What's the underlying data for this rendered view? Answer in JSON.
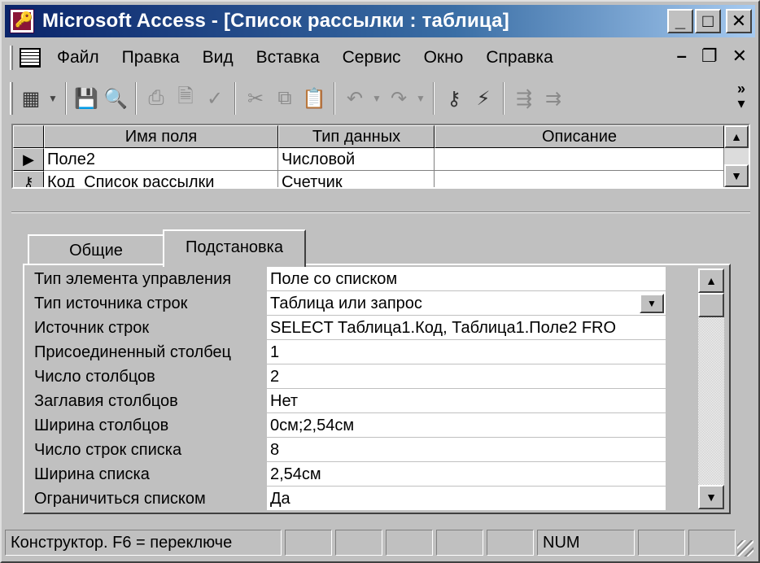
{
  "window": {
    "title": "Microsoft Access - [Список рассылки : таблица]",
    "buttons": {
      "minimize": "_",
      "maximize": "□",
      "close": "✕"
    }
  },
  "menu": {
    "items": [
      {
        "label": "Файл"
      },
      {
        "label": "Правка"
      },
      {
        "label": "Вид"
      },
      {
        "label": "Вставка"
      },
      {
        "label": "Сервис"
      },
      {
        "label": "Окно"
      },
      {
        "label": "Справка"
      }
    ],
    "doc_buttons": {
      "minimize": "–",
      "restore": "❐",
      "close": "✕"
    }
  },
  "toolbar": {
    "icons": [
      "view-icon",
      "save-icon",
      "search-icon",
      "print-icon",
      "print-preview-icon",
      "spelling-icon",
      "cut-icon",
      "copy-icon",
      "paste-icon",
      "undo-icon",
      "redo-icon",
      "primary-key-icon",
      "indexes-icon",
      "insert-rows-icon",
      "delete-rows-icon"
    ],
    "more": "»"
  },
  "grid": {
    "columns": [
      "Имя поля",
      "Тип данных",
      "Описание"
    ],
    "rows": [
      {
        "marker": "▶",
        "field": "Поле2",
        "type": "Числовой",
        "description": ""
      },
      {
        "marker": "⚷",
        "field": "Код_Список рассылки",
        "type": "Счетчик",
        "description": ""
      }
    ]
  },
  "tabs": [
    {
      "label": "Общие"
    },
    {
      "label": "Подстановка"
    }
  ],
  "properties": [
    {
      "label": "Тип элемента управления",
      "value": "Поле со списком"
    },
    {
      "label": "Тип источника строк",
      "value": "Таблица или запрос"
    },
    {
      "label": "Источник строк",
      "value": "SELECT Таблица1.Код, Таблица1.Поле2 FRO"
    },
    {
      "label": "Присоединенный столбец",
      "value": "1"
    },
    {
      "label": "Число столбцов",
      "value": "2"
    },
    {
      "label": "Заглавия столбцов",
      "value": "Нет"
    },
    {
      "label": "Ширина столбцов",
      "value": "0см;2,54см"
    },
    {
      "label": "Число строк списка",
      "value": "8"
    },
    {
      "label": "Ширина списка",
      "value": "2,54см"
    },
    {
      "label": "Ограничиться списком",
      "value": "Да"
    }
  ],
  "status": {
    "message": "Конструктор.  F6 = переключе",
    "num": "NUM"
  }
}
